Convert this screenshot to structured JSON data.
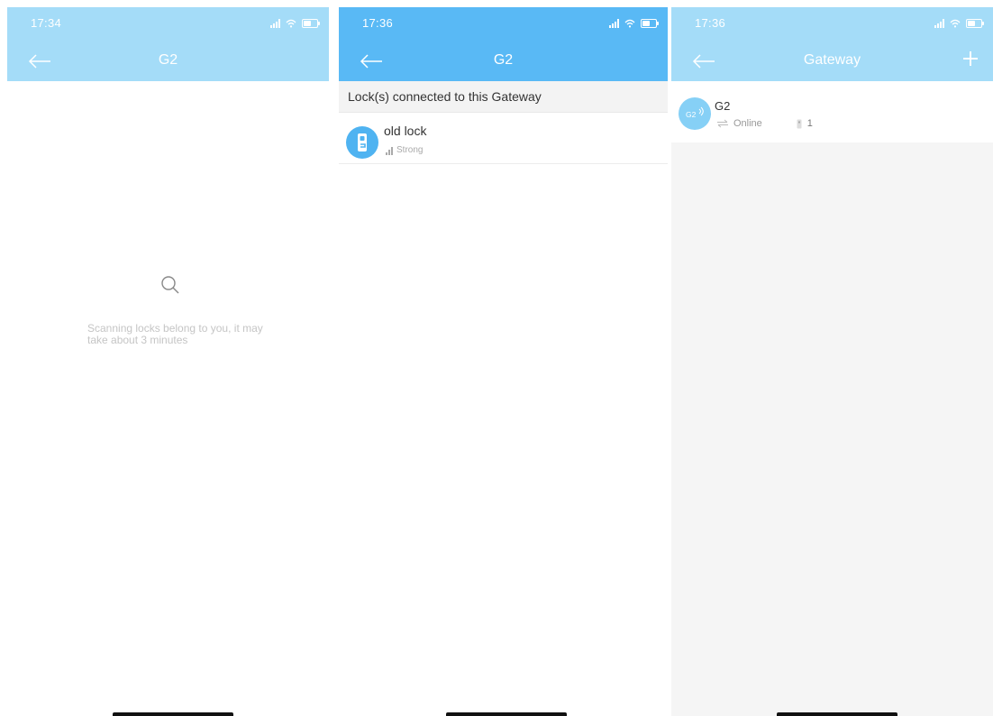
{
  "screens": [
    {
      "status": {
        "time": "17:34"
      },
      "nav": {
        "title": "G2"
      },
      "scan": {
        "message": "Scanning locks belong to you, it may take about 3 minutes"
      }
    },
    {
      "status": {
        "time": "17:36"
      },
      "nav": {
        "title": "G2"
      },
      "section_title": "Lock(s) connected to this Gateway",
      "locks": [
        {
          "name": "old lock",
          "signal": "Strong"
        }
      ]
    },
    {
      "status": {
        "time": "17:36"
      },
      "nav": {
        "title": "Gateway"
      },
      "gateways": [
        {
          "badge": "G2",
          "name": "G2",
          "status": "Online",
          "lock_count": "1"
        }
      ]
    }
  ],
  "colors": {
    "header_light": "#a4dcf8",
    "header_strong": "#59b9f5",
    "avatar_blue": "#4fb3f1"
  },
  "icons": [
    "back-arrow-icon",
    "search-icon",
    "lock-icon",
    "signal-icon",
    "gateway-icon",
    "sync-icon",
    "plus-icon",
    "wifi-icon",
    "battery-icon"
  ]
}
